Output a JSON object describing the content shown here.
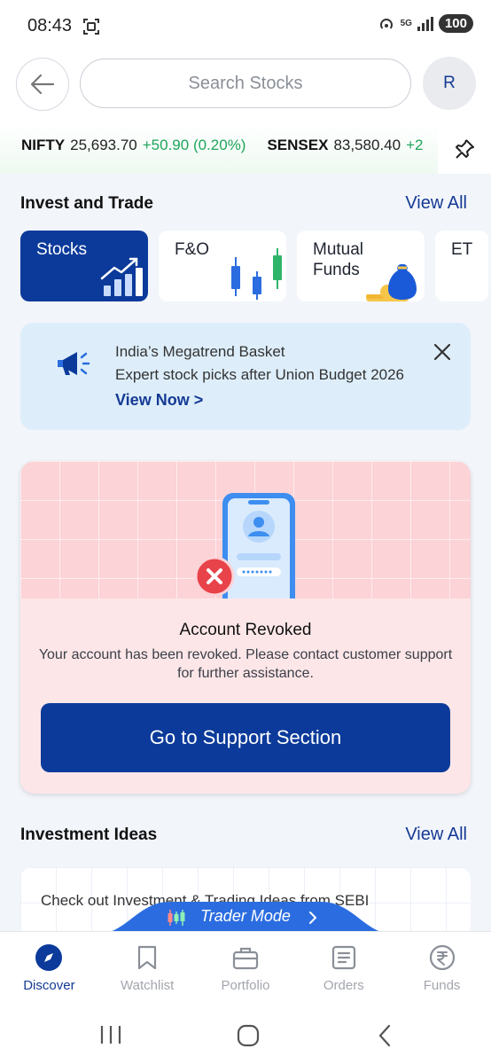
{
  "status_bar": {
    "time": "08:43",
    "network": "5G",
    "battery": "100"
  },
  "header": {
    "search_placeholder": "Search Stocks",
    "avatar_initial": "R"
  },
  "ticker": [
    {
      "name": "NIFTY",
      "value": "25,693.70",
      "change": "+50.90 (0.20%)"
    },
    {
      "name": "SENSEX",
      "value": "83,580.40",
      "change": "+2"
    }
  ],
  "invest": {
    "title": "Invest and Trade",
    "view_all": "View All",
    "categories": [
      {
        "label": "Stocks"
      },
      {
        "label": "F&O"
      },
      {
        "label": "Mutual\nFunds"
      },
      {
        "label": "ET"
      }
    ]
  },
  "banner": {
    "title": "India’s Megatrend Basket",
    "subtitle": "Expert stock picks after Union Budget 2026",
    "link": "View Now >"
  },
  "revoked": {
    "title": "Account Revoked",
    "message": "Your account has been revoked. Please contact customer support for further assistance.",
    "button": "Go to Support Section"
  },
  "ideas": {
    "title": "Investment Ideas",
    "view_all": "View All",
    "card_text": "Check out Investment & Trading Ideas from SEBI"
  },
  "trader_mode": {
    "label": "Trader Mode"
  },
  "bottom_nav": [
    {
      "label": "Discover",
      "icon": "compass-icon",
      "active": true
    },
    {
      "label": "Watchlist",
      "icon": "bookmark-icon",
      "active": false
    },
    {
      "label": "Portfolio",
      "icon": "briefcase-icon",
      "active": false
    },
    {
      "label": "Orders",
      "icon": "document-icon",
      "active": false
    },
    {
      "label": "Funds",
      "icon": "rupee-icon",
      "active": false
    }
  ],
  "colors": {
    "primary": "#0b3a9a",
    "positive": "#1ea55b",
    "error": "#e8434a"
  }
}
